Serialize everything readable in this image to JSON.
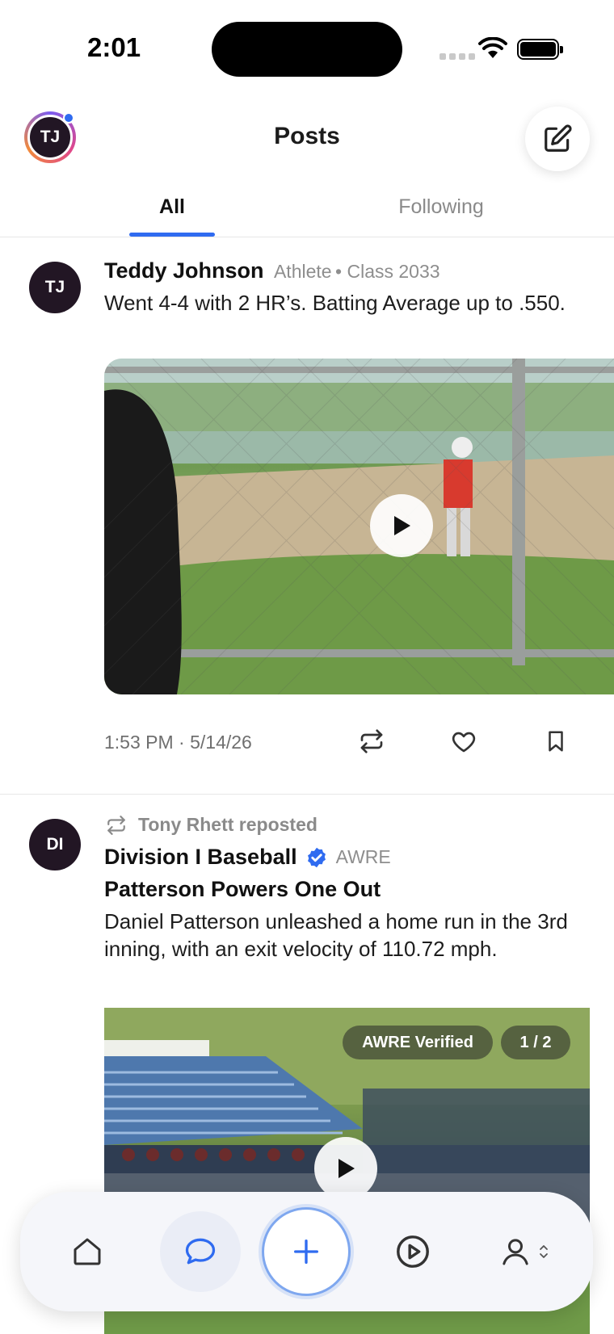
{
  "status_bar": {
    "time": "2:01"
  },
  "header": {
    "avatar_initials": "TJ",
    "title": "Posts"
  },
  "tabs": [
    {
      "label": "All",
      "active": true
    },
    {
      "label": "Following",
      "active": false
    }
  ],
  "posts": [
    {
      "avatar_initials": "TJ",
      "author": "Teddy Johnson",
      "role": "Athlete",
      "class": "Class 2033",
      "text": "Went 4-4 with 2 HR’s.  Batting Average up to .550.",
      "timestamp": "1:53 PM · 5/14/26",
      "media": "video"
    },
    {
      "avatar_initials": "DI",
      "reposted_by": "Tony Rhett reposted",
      "author": "Division I Baseball",
      "verified": true,
      "handle": "AWRE",
      "headline": "Patterson Powers One Out",
      "text": "Daniel Patterson unleashed a home run in the 3rd inning, with an exit velocity of 110.72 mph.",
      "media_badge": "AWRE Verified",
      "media_counter": "1 / 2"
    }
  ],
  "bottom_nav": [
    "home-icon",
    "chat-bubble-icon",
    "plus-icon",
    "play-circle-icon",
    "person-icon"
  ],
  "colors": {
    "accent": "#2f6bf0",
    "avatar_bg": "#221624",
    "muted": "#8e8e8e"
  }
}
